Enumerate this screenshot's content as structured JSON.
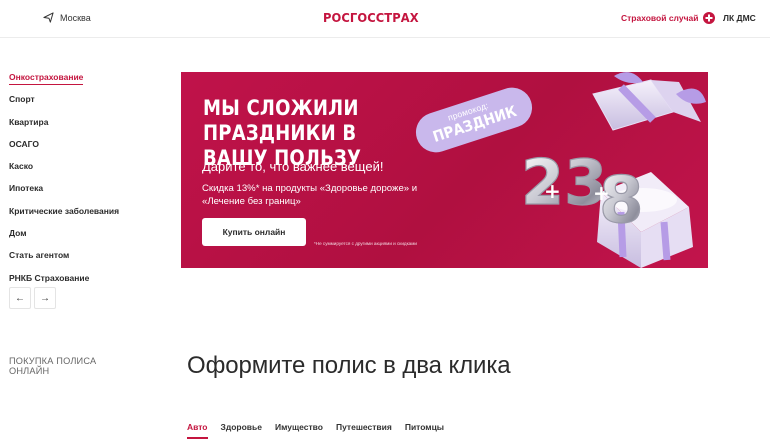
{
  "header": {
    "location": "Москва",
    "logo": "РОСГОССТРАХ",
    "claim_label": "Страховой случай",
    "lk_label": "ЛК ДМС",
    "location_icon": "navigation-arrow-icon",
    "claim_icon": "red-cross-icon"
  },
  "sidebar": {
    "items": [
      {
        "label": "Онкострахование"
      },
      {
        "label": "Спорт"
      },
      {
        "label": "Квартира"
      },
      {
        "label": "ОСАГО"
      },
      {
        "label": "Каско"
      },
      {
        "label": "Ипотека"
      },
      {
        "label": "Критические заболевания"
      },
      {
        "label": "Дом"
      },
      {
        "label": "Стать агентом"
      },
      {
        "label": "РНКБ Страхование"
      }
    ],
    "prev_arrow": "←",
    "next_arrow": "→"
  },
  "banner": {
    "title": "МЫ СЛОЖИЛИ ПРАЗДНИКИ В ВАШУ ПОЛЬЗУ",
    "subtitle": "Дарите то, что важнее вещей!",
    "description": "Скидка 13%* на продукты «Здоровье дороже» и «Лечение без границ»",
    "button_label": "Купить онлайн",
    "footnote": "*Не суммируется с другими акциями и скидками",
    "promo_label": "промокод:",
    "promo_code": "ПРАЗДНИК",
    "art_text": {
      "n1": "23",
      "n2": "8",
      "plus": "+"
    },
    "colors": {
      "background": "#b8124a",
      "promo": "#c9b8ec",
      "accent": "#c4153f"
    }
  },
  "section": {
    "label": "ПОКУПКА ПОЛИСА ОНЛАЙН",
    "title": "Оформите полис в два клика"
  },
  "tabs": [
    {
      "label": "Авто",
      "active": true
    },
    {
      "label": "Здоровье"
    },
    {
      "label": "Имущество"
    },
    {
      "label": "Путешествия"
    },
    {
      "label": "Питомцы"
    }
  ]
}
